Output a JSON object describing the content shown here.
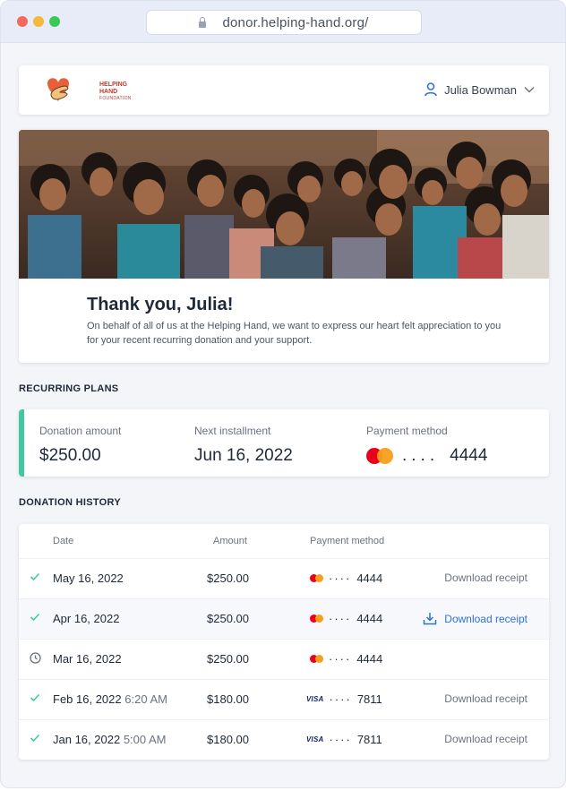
{
  "browser": {
    "url": "donor.helping-hand.org/"
  },
  "header": {
    "logo_line1": "HELPING",
    "logo_line2": "HAND",
    "logo_line3": "FOUNDATION",
    "user_name": "Julia Bowman"
  },
  "hero": {
    "title": "Thank you, Julia!",
    "text": "On behalf of all of us at the Helping Hand, we want to express our heart felt appreciation to you for your recent recurring donation and your support."
  },
  "recurring": {
    "section_title": "RECURRING PLANS",
    "amount_label": "Donation amount",
    "amount_value": "$250.00",
    "next_label": "Next installment",
    "next_value": "Jun 16, 2022",
    "payment_label": "Payment method",
    "payment_masked": "....",
    "payment_last4": "4444"
  },
  "history": {
    "section_title": "DONATION HISTORY",
    "col_date": "Date",
    "col_amount": "Amount",
    "col_payment": "Payment method",
    "rows": [
      {
        "status": "check-icon",
        "date": "May 16, 2022",
        "time": "",
        "amount": "$250.00",
        "card": "mastercard",
        "masked": "····",
        "last4": "4444",
        "action": "Download receipt"
      },
      {
        "status": "check-icon",
        "date": "Apr 16, 2022",
        "time": "",
        "amount": "$250.00",
        "card": "mastercard",
        "masked": "····",
        "last4": "4444",
        "action": "Download receipt"
      },
      {
        "status": "clock-icon",
        "date": "Mar 16, 2022",
        "time": "",
        "amount": "$250.00",
        "card": "mastercard",
        "masked": "····",
        "last4": "4444",
        "action": ""
      },
      {
        "status": "check-icon",
        "date": "Feb 16, 2022",
        "time": "6:20 AM",
        "amount": "$180.00",
        "card": "visa",
        "card_label": "VISA",
        "masked": "····",
        "last4": "7811",
        "action": "Download receipt"
      },
      {
        "status": "check-icon",
        "date": "Jan 16, 2022",
        "time": "5:00 AM",
        "amount": "$180.00",
        "card": "visa",
        "card_label": "VISA",
        "masked": "····",
        "last4": "7811",
        "action": "Download receipt"
      }
    ]
  },
  "colors": {
    "accent_green": "#40c8a0",
    "link_blue": "#2d72d9",
    "mastercard_red": "#eb001b",
    "mastercard_orange": "#f79e1b",
    "visa_blue": "#1a1f71"
  }
}
